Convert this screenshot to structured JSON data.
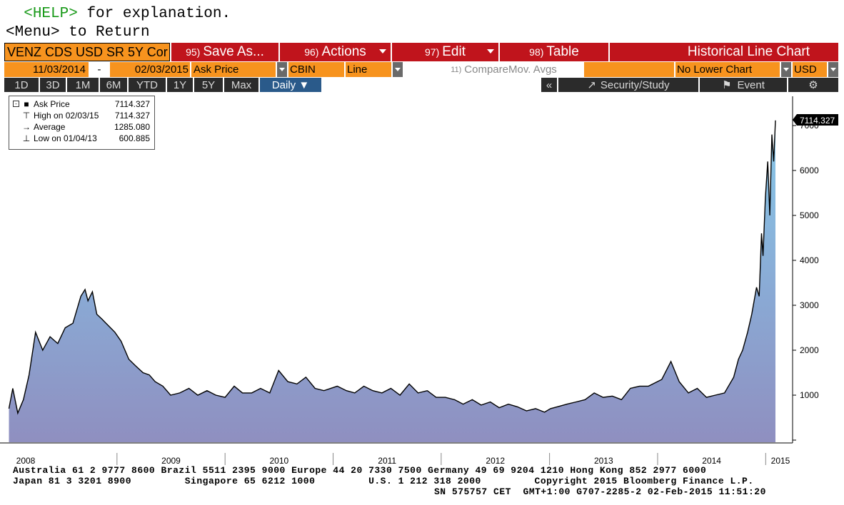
{
  "terminal": {
    "help_key": "<HELP>",
    "help_text": " for explanation.",
    "menu_key": "<Menu>",
    "menu_text": " to Return"
  },
  "toolbar": {
    "ticker": "VENZ CDS USD SR 5Y Cor",
    "save_num": "95)",
    "save_label": "Save As...",
    "actions_num": "96)",
    "actions_label": "Actions",
    "edit_num": "97)",
    "edit_label": "Edit",
    "table_num": "98)",
    "table_label": "Table",
    "chart_title": "Historical Line Chart"
  },
  "settings": {
    "start_date": "11/03/2014",
    "separator": "-",
    "end_date": "02/03/2015",
    "field": "Ask Price",
    "source": "CBIN",
    "chart_style": "Line",
    "compare_num": "11)",
    "compare_label": "Compare",
    "mov_avgs": "Mov. Avgs",
    "lower_chart": "No Lower Chart",
    "currency": "USD"
  },
  "periods": {
    "items": [
      "1D",
      "3D",
      "1M",
      "6M",
      "YTD",
      "1Y",
      "5Y",
      "Max"
    ],
    "frequency": "Daily ▼",
    "collapse": "«",
    "security_study": "Security/Study",
    "event": "Event",
    "settings_icon": "⚙"
  },
  "legend": {
    "ask_name": "Ask Price",
    "ask_val": "7114.327",
    "high_name": "High on 02/03/15",
    "high_val": "7114.327",
    "avg_name": "Average",
    "avg_val": "1285.080",
    "low_name": "Low on 01/04/13",
    "low_val": "600.885"
  },
  "last_price_label": "7114.327",
  "colors": {
    "accent_orange": "#f7931e",
    "toolbar_red": "#c0141c",
    "area_top": "#87c8e8",
    "area_bottom": "#8f8fc0"
  },
  "chart_data": {
    "type": "area",
    "title": "",
    "xlabel": "",
    "ylabel": "",
    "series": [
      {
        "x": [
          "2008-01-02",
          "2008-01-15",
          "2008-02-01",
          "2008-02-20",
          "2008-03-10",
          "2008-04-01",
          "2008-04-25",
          "2008-05-20",
          "2008-06-15",
          "2008-07-10",
          "2008-08-05",
          "2008-09-01",
          "2008-09-15",
          "2008-09-25",
          "2008-10-10",
          "2008-10-25",
          "2008-11-10",
          "2008-11-25",
          "2008-12-10",
          "2008-12-25",
          "2009-01-15",
          "2009-02-10",
          "2009-03-05",
          "2009-03-30",
          "2009-04-20",
          "2009-05-10",
          "2009-06-05",
          "2009-07-01",
          "2009-08-01",
          "2009-09-01",
          "2009-10-01",
          "2009-11-01",
          "2009-12-01",
          "2010-01-01",
          "2010-02-01",
          "2010-03-01",
          "2010-04-01",
          "2010-05-01",
          "2010-06-01",
          "2010-07-01",
          "2010-08-01",
          "2010-09-01",
          "2010-10-01",
          "2010-11-01",
          "2010-12-01",
          "2011-01-15",
          "2011-02-15",
          "2011-03-15",
          "2011-04-15",
          "2011-05-15",
          "2011-06-15",
          "2011-07-15",
          "2011-08-15",
          "2011-09-15",
          "2011-10-15",
          "2011-11-15",
          "2011-12-15",
          "2012-01-15",
          "2012-02-15",
          "2012-03-15",
          "2012-04-15",
          "2012-05-15",
          "2012-06-15",
          "2012-07-15",
          "2012-08-15",
          "2012-09-15",
          "2012-10-15",
          "2012-11-15",
          "2012-12-15",
          "2013-01-04",
          "2013-02-01",
          "2013-03-01",
          "2013-04-01",
          "2013-05-01",
          "2013-06-01",
          "2013-07-01",
          "2013-08-01",
          "2013-09-01",
          "2013-10-01",
          "2013-11-01",
          "2013-12-01",
          "2014-01-15",
          "2014-02-15",
          "2014-03-15",
          "2014-04-15",
          "2014-05-15",
          "2014-06-15",
          "2014-07-15",
          "2014-08-15",
          "2014-09-15",
          "2014-10-01",
          "2014-10-15",
          "2014-11-01",
          "2014-11-15",
          "2014-12-01",
          "2014-12-10",
          "2014-12-18",
          "2014-12-23",
          "2014-12-31",
          "2015-01-08",
          "2015-01-15",
          "2015-01-22",
          "2015-01-28",
          "2015-02-03"
        ],
        "y": [
          700,
          1150,
          600,
          900,
          1450,
          2400,
          2000,
          2300,
          2150,
          2500,
          2600,
          3200,
          3350,
          3100,
          3300,
          2800,
          2700,
          2600,
          2500,
          2400,
          2200,
          1800,
          1650,
          1500,
          1450,
          1300,
          1200,
          1000,
          1050,
          1150,
          1000,
          1100,
          1000,
          950,
          1200,
          1050,
          1050,
          1150,
          1050,
          1550,
          1300,
          1250,
          1400,
          1150,
          1100,
          1200,
          1100,
          1050,
          1200,
          1100,
          1050,
          1150,
          1000,
          1250,
          1050,
          1100,
          950,
          950,
          900,
          800,
          900,
          780,
          850,
          720,
          800,
          740,
          650,
          700,
          620,
          700,
          750,
          800,
          850,
          900,
          1050,
          950,
          980,
          900,
          1150,
          1200,
          1200,
          1350,
          1750,
          1300,
          1050,
          1150,
          950,
          1000,
          1050,
          1400,
          1800,
          2000,
          2400,
          2800,
          3400,
          3200,
          4600,
          4100,
          5400,
          6200,
          5000,
          6800,
          6200,
          7114
        ]
      }
    ],
    "x_tick_labels": [
      "2008",
      "2009",
      "2010",
      "2011",
      "2012",
      "2013",
      "2014",
      "2015"
    ],
    "y_tick_labels": [
      "1000",
      "2000",
      "3000",
      "4000",
      "5000",
      "6000",
      "7000"
    ],
    "ylim": [
      0,
      7600
    ],
    "grid": false,
    "legend_placement": "top-left",
    "y_axis_side": "right"
  },
  "footer": {
    "line1": "Australia 61 2 9777 8600 Brazil 5511 2395 9000 Europe 44 20 7330 7500 Germany 49 69 9204 1210 Hong Kong 852 2977 6000",
    "line2": "Japan 81 3 3201 8900         Singapore 65 6212 1000         U.S. 1 212 318 2000         Copyright 2015 Bloomberg Finance L.P.",
    "line3": "SN 575757 CET  GMT+1:00 G707-2285-2 02-Feb-2015 11:51:20"
  }
}
